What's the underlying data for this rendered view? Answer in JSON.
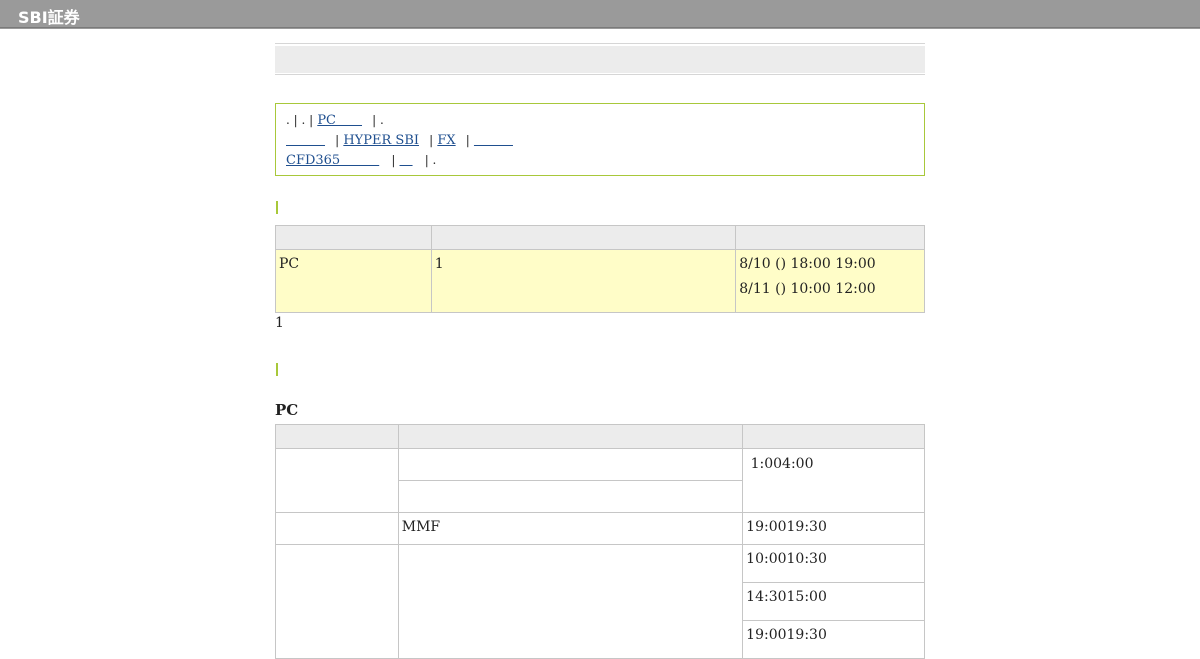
{
  "header": {
    "logo_text": "SBI証券",
    "bar_color": "#9a9a9a"
  },
  "nav": {
    "line1": {
      "prefix": ". | . |",
      "link_pc": "PC　　",
      "suffix": "| ."
    },
    "line2": {
      "link_a": "　　　",
      "sep1": "|",
      "link_hyper": "HYPER SBI",
      "sep2": "|",
      "link_fx": "FX",
      "sep3": "|",
      "link_b": "　　　"
    },
    "line3": {
      "link_cfd": "CFD365　　　",
      "sep1": "|",
      "link_c": "　",
      "suffix": "| ."
    }
  },
  "section1": {
    "marker": "|",
    "table": {
      "headers": [
        "",
        "",
        ""
      ],
      "rows": [
        {
          "col1": "PC",
          "col2": "1",
          "col3_lines": [
            "8/10 () 18:00  19:00",
            "8/11 () 10:00  12:00"
          ]
        }
      ]
    },
    "note": "1"
  },
  "section2": {
    "marker": "|",
    "subheading": "PC",
    "table": {
      "headers": [
        "",
        "",
        ""
      ],
      "rows": [
        {
          "col1": "",
          "col2a": "",
          "col2b": "",
          "col3": " 1:004:00"
        },
        {
          "col1": "",
          "col2": "MMF",
          "col3": "19:0019:30"
        },
        {
          "col1": "",
          "col2": "",
          "col3_lines": [
            "10:0010:30",
            "14:3015:00",
            "19:0019:30"
          ]
        }
      ]
    }
  },
  "colors": {
    "accent_green": "#a8c83a",
    "link_blue": "#1f4f8f",
    "row_yellow": "#fffdc8",
    "header_grey": "#ececec"
  }
}
